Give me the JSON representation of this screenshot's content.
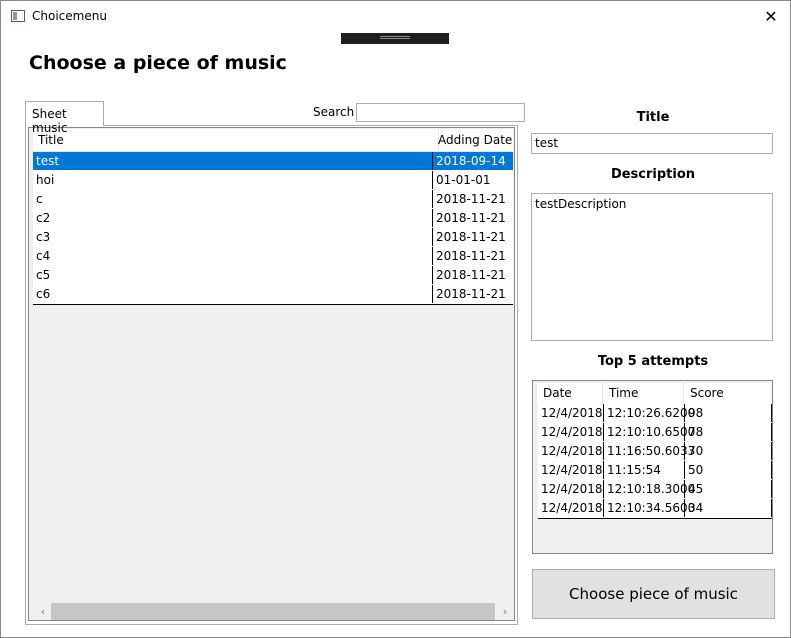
{
  "window": {
    "title": "Choicemenu",
    "close_glyph": "✕",
    "icon": "window-icon"
  },
  "heading": "Choose a piece of music",
  "tab_label": "Sheet music",
  "search": {
    "label": "Search",
    "value": ""
  },
  "music_table": {
    "columns": [
      "Title",
      "Adding Date"
    ],
    "rows": [
      {
        "title": "test",
        "date": "2018-09-14",
        "selected": true
      },
      {
        "title": "hoi",
        "date": "01-01-01"
      },
      {
        "title": "c",
        "date": "2018-11-21"
      },
      {
        "title": "c2",
        "date": "2018-11-21"
      },
      {
        "title": "c3",
        "date": "2018-11-21"
      },
      {
        "title": "c4",
        "date": "2018-11-21"
      },
      {
        "title": "c5",
        "date": "2018-11-21"
      },
      {
        "title": "c6",
        "date": "2018-11-21"
      }
    ],
    "selection_color": "#0078d7"
  },
  "details": {
    "title_label": "Title",
    "title_value": "test",
    "description_label": "Description",
    "description_value": "testDescription",
    "attempts_label": "Top 5 attempts"
  },
  "attempts_table": {
    "columns": [
      "Date",
      "Time",
      "Score"
    ],
    "rows": [
      [
        "12/4/2018",
        "12:10:26.6200",
        "98"
      ],
      [
        "12/4/2018",
        "12:10:10.6500",
        "78"
      ],
      [
        "12/4/2018",
        "11:16:50.6033",
        "70"
      ],
      [
        "12/4/2018",
        "11:15:54",
        "50"
      ],
      [
        "12/4/2018",
        "12:10:18.3000",
        "45"
      ],
      [
        "12/4/2018",
        "12:10:34.5600",
        "34"
      ]
    ]
  },
  "choose_button_label": "Choose piece of music"
}
